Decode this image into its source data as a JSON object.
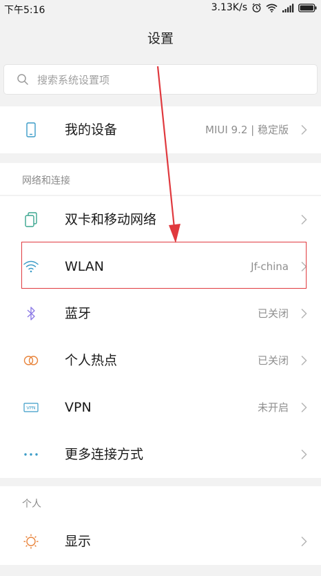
{
  "status_bar": {
    "time": "下午5:16",
    "net_speed": "3.13K/s"
  },
  "title": "设置",
  "search": {
    "placeholder": "搜索系统设置项"
  },
  "my_device": {
    "label": "我的设备",
    "value": "MIUI 9.2 | 稳定版"
  },
  "sections": {
    "network": "网络和连接",
    "personal": "个人"
  },
  "network_items": [
    {
      "label": "双卡和移动网络",
      "value": "",
      "icon": "sim-cards-icon"
    },
    {
      "label": "WLAN",
      "value": "Jf-china",
      "icon": "wifi-icon"
    },
    {
      "label": "蓝牙",
      "value": "已关闭",
      "icon": "bluetooth-icon"
    },
    {
      "label": "个人热点",
      "value": "已关闭",
      "icon": "hotspot-icon"
    },
    {
      "label": "VPN",
      "value": "未开启",
      "icon": "vpn-icon"
    },
    {
      "label": "更多连接方式",
      "value": "",
      "icon": "more-dots-icon"
    }
  ],
  "personal_items": [
    {
      "label": "显示",
      "value": "",
      "icon": "display-sun-icon"
    }
  ],
  "colors": {
    "accent": "#3a9bc7",
    "annotation_red": "#e0393e",
    "bluetooth": "#8c7ae6",
    "hotspot": "#e8833a",
    "display": "#e8833a"
  },
  "annotation": {
    "arrow_color": "#e0393e",
    "highlights": "WLAN"
  }
}
